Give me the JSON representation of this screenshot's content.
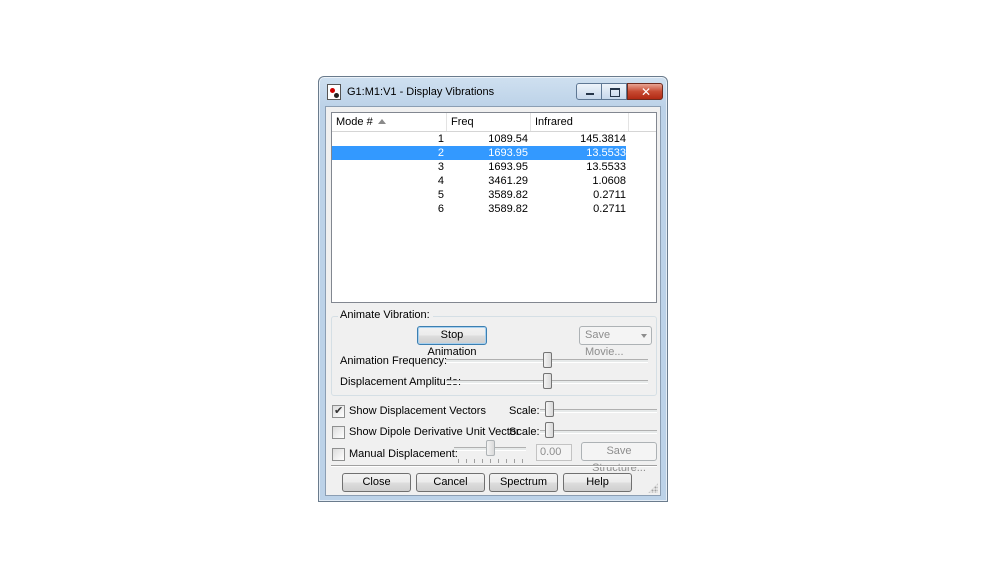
{
  "window": {
    "title": "G1:M1:V1 - Display Vibrations",
    "close_glyph": "✕"
  },
  "table": {
    "columns": [
      "Mode #",
      "Freq",
      "Infrared"
    ],
    "rows": [
      {
        "mode": "1",
        "freq": "1089.54",
        "ir": "145.3814",
        "selected": false
      },
      {
        "mode": "2",
        "freq": "1693.95",
        "ir": "13.5533",
        "selected": true
      },
      {
        "mode": "3",
        "freq": "1693.95",
        "ir": "13.5533",
        "selected": false
      },
      {
        "mode": "4",
        "freq": "3461.29",
        "ir": "1.0608",
        "selected": false
      },
      {
        "mode": "5",
        "freq": "3589.82",
        "ir": "0.2711",
        "selected": false
      },
      {
        "mode": "6",
        "freq": "3589.82",
        "ir": "0.2711",
        "selected": false
      }
    ]
  },
  "animate": {
    "group_label": "Animate Vibration:",
    "stop_animation_label": "Stop Animation",
    "save_movie_label": "Save Movie...",
    "frequency_label": "Animation Frequency:",
    "amplitude_label": "Displacement Amplitude:",
    "frequency_level": 0.5,
    "amplitude_level": 0.5
  },
  "options": {
    "show_displacement_vectors": {
      "label": "Show Displacement Vectors",
      "checked": true,
      "scale_label": "Scale:",
      "scale_level": 0.05
    },
    "show_dipole_derivative": {
      "label": "Show Dipole Derivative Unit Vector",
      "checked": false,
      "scale_label": "Scale:",
      "scale_level": 0.05
    },
    "manual_displacement": {
      "label": "Manual Displacement:",
      "checked": false,
      "value": "0.00",
      "level": 0.5
    },
    "save_structure_label": "Save Structure..."
  },
  "buttons": {
    "close": "Close",
    "cancel": "Cancel",
    "spectrum": "Spectrum",
    "help": "Help"
  },
  "colors": {
    "selection": "#3399ff",
    "close_button": "#c74a32"
  }
}
